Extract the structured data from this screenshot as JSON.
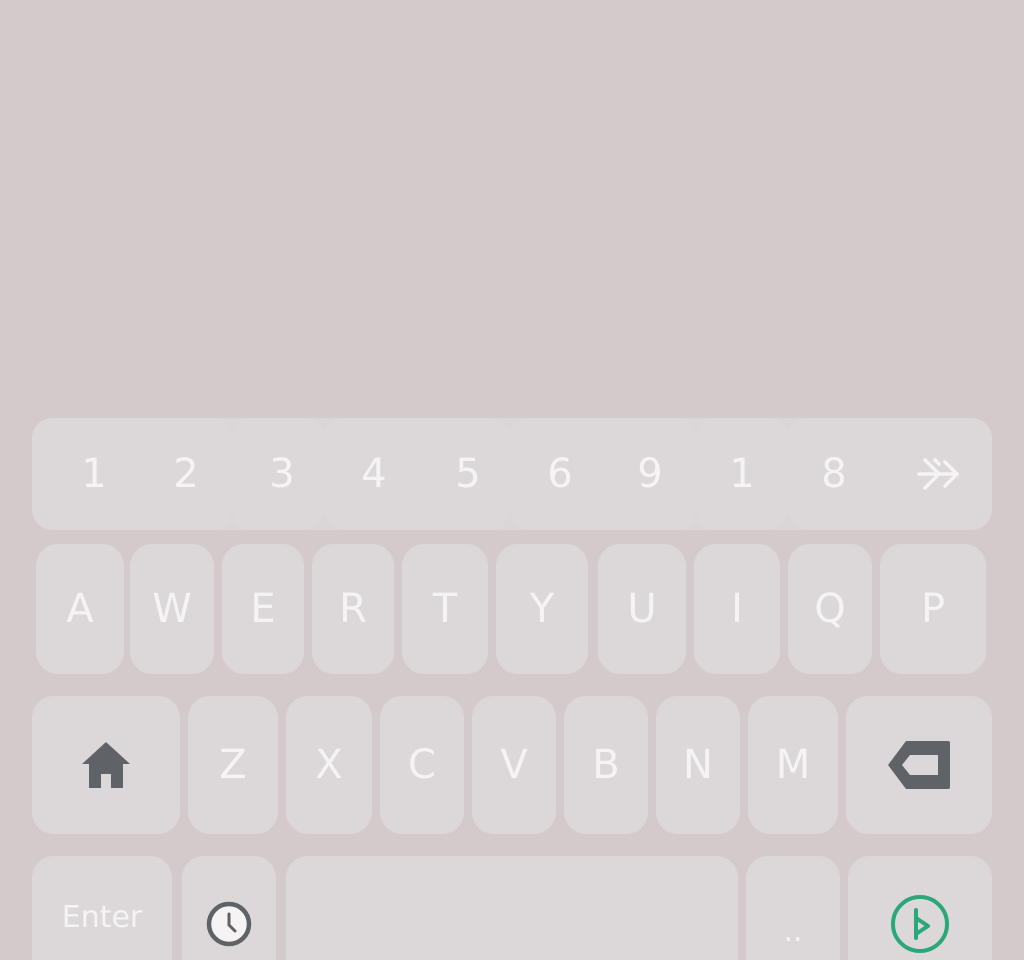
{
  "keyboard": {
    "number_row": [
      "1",
      "2",
      "3",
      "4",
      "5",
      "6",
      "9",
      "1",
      "8"
    ],
    "letter_row_1": [
      "A",
      "W",
      "E",
      "R",
      "T",
      "Y",
      "U",
      "I",
      "Q",
      "P"
    ],
    "letter_row_2": [
      "Z",
      "X",
      "C",
      "V",
      "B",
      "N",
      "M"
    ],
    "enter_label": "Enter",
    "punctuation_label": "..",
    "icons": {
      "number_row_end": "swipe-arrow-icon",
      "left_of_row_2": "home-icon",
      "right_of_row_2": "backspace-icon",
      "bottom_left_2": "clock-icon",
      "bottom_right": "send-play-icon"
    }
  },
  "colors": {
    "background": "#d5cacb",
    "key": "#dcd8d9",
    "key_text": "#f5f3f3",
    "icon_dark": "#5f6266",
    "accent_green": "#2aa87a"
  }
}
